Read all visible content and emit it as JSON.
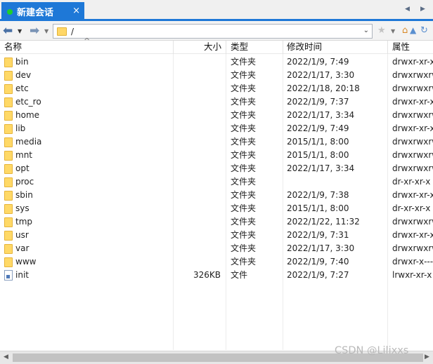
{
  "tab": {
    "title": "新建会话",
    "close": "×"
  },
  "tab_nav": {
    "left": "◀",
    "right": "▶"
  },
  "toolbar": {
    "back": "⬅",
    "back_dd": "▼",
    "forward": "➡",
    "forward_dd": "▼",
    "path": "/",
    "path_dd": "⌄",
    "star": "★",
    "star_dd": "▼",
    "home": "⌂",
    "up": "▲",
    "refresh": "↻"
  },
  "columns": {
    "name": "名称",
    "size": "大小",
    "type": "类型",
    "mtime": "修改时间",
    "attr": "属性",
    "sort_caret": "^"
  },
  "rows": [
    {
      "name": "bin",
      "size": "",
      "type": "文件夹",
      "mtime": "2022/1/9, 7:49",
      "attr": "drwxr-xr-x",
      "kind": "folder"
    },
    {
      "name": "dev",
      "size": "",
      "type": "文件夹",
      "mtime": "2022/1/17, 3:30",
      "attr": "drwxrwxrwx",
      "kind": "folder"
    },
    {
      "name": "etc",
      "size": "",
      "type": "文件夹",
      "mtime": "2022/1/18, 20:18",
      "attr": "drwxrwxrwx",
      "kind": "folder"
    },
    {
      "name": "etc_ro",
      "size": "",
      "type": "文件夹",
      "mtime": "2022/1/9, 7:37",
      "attr": "drwxr-xr-x",
      "kind": "folder"
    },
    {
      "name": "home",
      "size": "",
      "type": "文件夹",
      "mtime": "2022/1/17, 3:34",
      "attr": "drwxrwxrwx",
      "kind": "folder"
    },
    {
      "name": "lib",
      "size": "",
      "type": "文件夹",
      "mtime": "2022/1/9, 7:49",
      "attr": "drwxr-xr-x",
      "kind": "folder"
    },
    {
      "name": "media",
      "size": "",
      "type": "文件夹",
      "mtime": "2015/1/1, 8:00",
      "attr": "drwxrwxrwx",
      "kind": "folder"
    },
    {
      "name": "mnt",
      "size": "",
      "type": "文件夹",
      "mtime": "2015/1/1, 8:00",
      "attr": "drwxrwxrwx",
      "kind": "folder"
    },
    {
      "name": "opt",
      "size": "",
      "type": "文件夹",
      "mtime": "2022/1/17, 3:34",
      "attr": "drwxrwxrwx",
      "kind": "folder"
    },
    {
      "name": "proc",
      "size": "",
      "type": "文件夹",
      "mtime": "",
      "attr": "dr-xr-xr-x",
      "kind": "folder"
    },
    {
      "name": "sbin",
      "size": "",
      "type": "文件夹",
      "mtime": "2022/1/9, 7:38",
      "attr": "drwxr-xr-x",
      "kind": "folder"
    },
    {
      "name": "sys",
      "size": "",
      "type": "文件夹",
      "mtime": "2015/1/1, 8:00",
      "attr": "dr-xr-xr-x",
      "kind": "folder"
    },
    {
      "name": "tmp",
      "size": "",
      "type": "文件夹",
      "mtime": "2022/1/22, 11:32",
      "attr": "drwxrwxrwx",
      "kind": "folder"
    },
    {
      "name": "usr",
      "size": "",
      "type": "文件夹",
      "mtime": "2022/1/9, 7:31",
      "attr": "drwxr-xr-x",
      "kind": "folder"
    },
    {
      "name": "var",
      "size": "",
      "type": "文件夹",
      "mtime": "2022/1/17, 3:30",
      "attr": "drwxrwxrwx",
      "kind": "folder"
    },
    {
      "name": "www",
      "size": "",
      "type": "文件夹",
      "mtime": "2022/1/9, 7:40",
      "attr": "drwxr-x---",
      "kind": "folder"
    },
    {
      "name": "init",
      "size": "326KB",
      "type": "文件",
      "mtime": "2022/1/9, 7:27",
      "attr": "lrwxr-xr-x",
      "kind": "file"
    }
  ],
  "scrollbar": {
    "left": "◀",
    "right": "▶"
  },
  "watermark": "CSDN @Lilixxs",
  "colors": {
    "accent": "#1e78d7",
    "status_dot": "#1fcf2d",
    "folder": "#ffd967"
  }
}
